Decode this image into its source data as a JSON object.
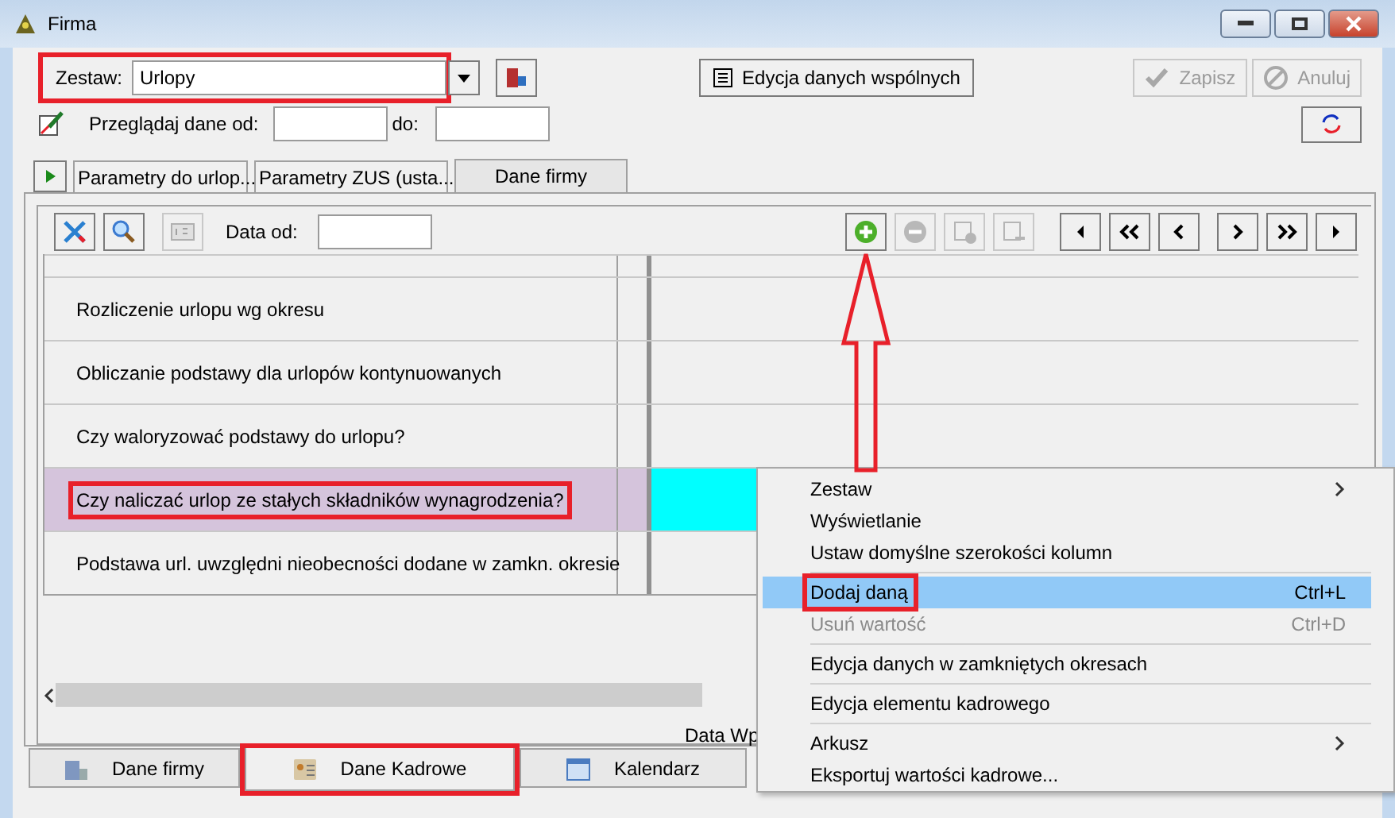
{
  "window": {
    "title": "Firma"
  },
  "zestaw": {
    "label": "Zestaw:",
    "value": "Urlopy",
    "highlighted": true
  },
  "shared_button": {
    "label": "Edycja danych wspólnych"
  },
  "actions": [
    {
      "label": "Zapisz",
      "disabled": true
    },
    {
      "label": "Anuluj",
      "disabled": true
    }
  ],
  "browse": {
    "label": "Przeglądaj dane od:",
    "to_label": "do:"
  },
  "top_tabs": [
    {
      "label": "Parametry do urlop...",
      "selected": false
    },
    {
      "label": "Parametry ZUS (usta...",
      "selected": false
    },
    {
      "label": "Dane firmy",
      "selected": true
    }
  ],
  "grid_toolbar": {
    "date_label": "Data od:",
    "record_buttons": [
      {
        "disabled": false
      },
      {
        "disabled": true
      },
      {
        "disabled": true
      },
      {
        "disabled": true
      }
    ]
  },
  "rows": [
    {
      "label": "Rozliczenie urlopu wg okresu",
      "selected": false,
      "highlighted": false
    },
    {
      "label": "Obliczanie podstawy dla urlopów kontynuowanych",
      "selected": false,
      "highlighted": false
    },
    {
      "label": "Czy waloryzować podstawy do urlopu?",
      "selected": false,
      "highlighted": false
    },
    {
      "label": "Czy naliczać urlop ze stałych składników wynagrodzenia?",
      "selected": true,
      "highlighted": true
    },
    {
      "label": "Podstawa url. uwzględni nieobecności dodane w zamkn. okresie",
      "selected": false,
      "highlighted": false
    }
  ],
  "footer_text": "Data Wp",
  "bottom_tabs": [
    {
      "label": "Dane firmy",
      "selected": false,
      "highlighted": false
    },
    {
      "label": "Dane Kadrowe",
      "selected": true,
      "highlighted": true
    },
    {
      "label": "Kalendarz",
      "selected": false,
      "highlighted": false
    }
  ],
  "context_menu": [
    {
      "label": "Zestaw",
      "submenu": true,
      "separator_before": false,
      "selected": false,
      "disabled": false,
      "highlighted": false
    },
    {
      "label": "Wyświetlanie",
      "submenu": false,
      "separator_before": false,
      "selected": false,
      "disabled": false,
      "highlighted": false
    },
    {
      "label": "Ustaw domyślne szerokości kolumn",
      "submenu": false,
      "separator_before": false,
      "selected": false,
      "disabled": false,
      "highlighted": false
    },
    {
      "label": "Dodaj daną",
      "shortcut": "Ctrl+L",
      "submenu": false,
      "separator_before": true,
      "selected": true,
      "disabled": false,
      "highlighted": true
    },
    {
      "label": "Usuń wartość",
      "shortcut": "Ctrl+D",
      "submenu": false,
      "separator_before": false,
      "selected": false,
      "disabled": true,
      "highlighted": false
    },
    {
      "label": "Edycja danych w zamkniętych okresach",
      "submenu": false,
      "separator_before": true,
      "selected": false,
      "disabled": false,
      "highlighted": false
    },
    {
      "label": "Edycja elementu kadrowego",
      "submenu": false,
      "separator_before": true,
      "selected": false,
      "disabled": false,
      "highlighted": false
    },
    {
      "label": "Arkusz",
      "submenu": true,
      "separator_before": true,
      "selected": false,
      "disabled": false,
      "highlighted": false
    },
    {
      "label": "Eksportuj wartości kadrowe...",
      "submenu": false,
      "separator_before": false,
      "selected": false,
      "disabled": false,
      "highlighted": false
    }
  ]
}
